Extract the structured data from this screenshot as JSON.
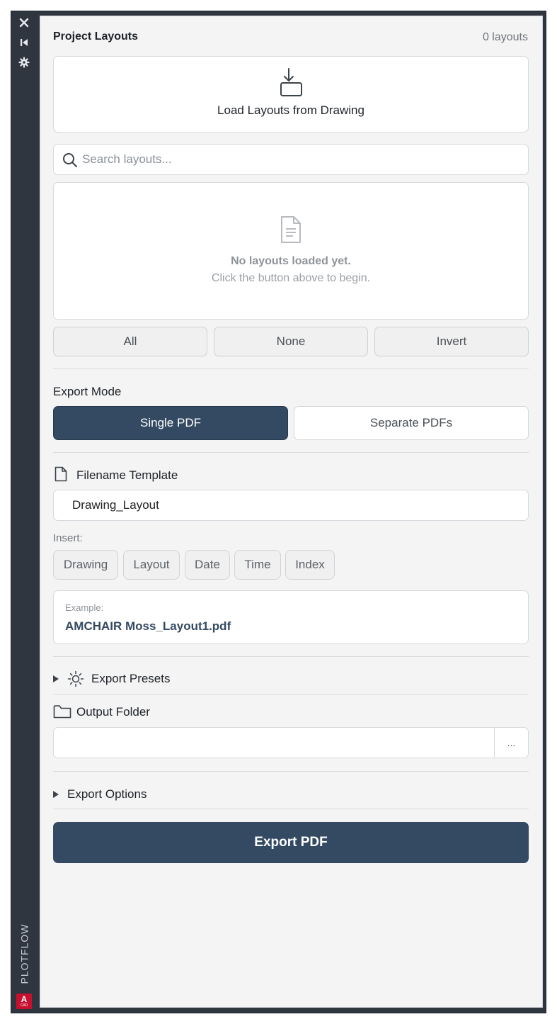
{
  "sidebar": {
    "title": "PLOTFLOW",
    "logo_letter": "A",
    "logo_sub": "CAD",
    "buttons": [
      {
        "icon": "close-icon"
      },
      {
        "icon": "collapse-icon"
      },
      {
        "icon": "gear-icon"
      }
    ]
  },
  "layouts": {
    "title": "Project Layouts",
    "count": "0 layouts",
    "load_label": "Load Layouts from Drawing",
    "search_placeholder": "Search layouts...",
    "empty_title": "No layouts loaded yet.",
    "empty_hint": "Click the button above to begin.",
    "select_all": "All",
    "select_none": "None",
    "select_invert": "Invert"
  },
  "export_mode": {
    "title": "Export Mode",
    "single": "Single PDF",
    "separate": "Separate PDFs",
    "selected": "Single PDF"
  },
  "filename": {
    "title": "Filename Template",
    "value": "Drawing_Layout",
    "insert_label": "Insert:",
    "chips": [
      "Drawing",
      "Layout",
      "Date",
      "Time",
      "Index"
    ],
    "example_label": "Example:",
    "example_value": "AMCHAIR Moss_Layout1.pdf"
  },
  "presets": {
    "title": "Export Presets"
  },
  "output": {
    "title": "Output Folder",
    "value": "",
    "browse_label": "..."
  },
  "options": {
    "title": "Export Options"
  },
  "export_button": "Export PDF",
  "colors": {
    "sidebar_bg": "#2f3640",
    "panel_bg": "#f4f4f4",
    "accent": "#344a62",
    "logo_red": "#c8102e"
  }
}
